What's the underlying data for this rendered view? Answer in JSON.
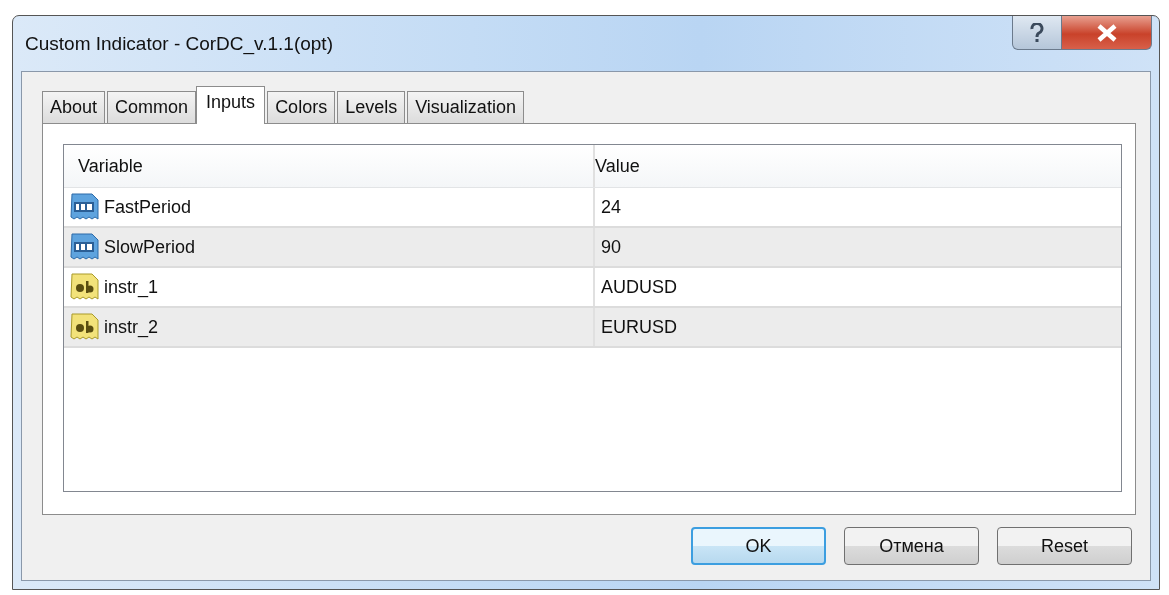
{
  "window": {
    "title": "Custom Indicator - CorDC_v.1.1(opt)"
  },
  "tabs": [
    {
      "label": "About",
      "selected": false
    },
    {
      "label": "Common",
      "selected": false
    },
    {
      "label": "Inputs",
      "selected": true
    },
    {
      "label": "Colors",
      "selected": false
    },
    {
      "label": "Levels",
      "selected": false
    },
    {
      "label": "Visualization",
      "selected": false
    }
  ],
  "table": {
    "columns": [
      "Variable",
      "Value"
    ],
    "rows": [
      {
        "kind": "int",
        "variable": "FastPeriod",
        "value": "24"
      },
      {
        "kind": "int",
        "variable": "SlowPeriod",
        "value": "90"
      },
      {
        "kind": "string",
        "variable": "instr_1",
        "value": "AUDUSD"
      },
      {
        "kind": "string",
        "variable": "instr_2",
        "value": "EURUSD"
      }
    ]
  },
  "buttons": [
    {
      "label": "OK",
      "kind": "default"
    },
    {
      "label": "Отмена",
      "kind": "normal"
    },
    {
      "label": "Reset",
      "kind": "normal"
    }
  ]
}
